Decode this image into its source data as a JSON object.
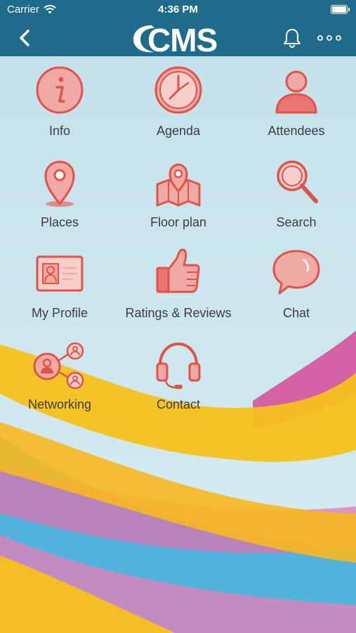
{
  "status_bar": {
    "carrier": "Carrier",
    "time": "4:36 PM"
  },
  "header": {
    "logo_text": "CMS"
  },
  "menu": {
    "items": [
      {
        "label": "Info"
      },
      {
        "label": "Agenda"
      },
      {
        "label": "Attendees"
      },
      {
        "label": "Places"
      },
      {
        "label": "Floor plan"
      },
      {
        "label": "Search"
      },
      {
        "label": "My Profile"
      },
      {
        "label": "Ratings & Reviews"
      },
      {
        "label": "Chat"
      },
      {
        "label": "Networking"
      },
      {
        "label": "Contact"
      }
    ]
  },
  "colors": {
    "header": "#1e6b8c",
    "icon_stroke": "#e0534a",
    "icon_fill": "#f1a9a3",
    "label": "#3d3d3d"
  }
}
